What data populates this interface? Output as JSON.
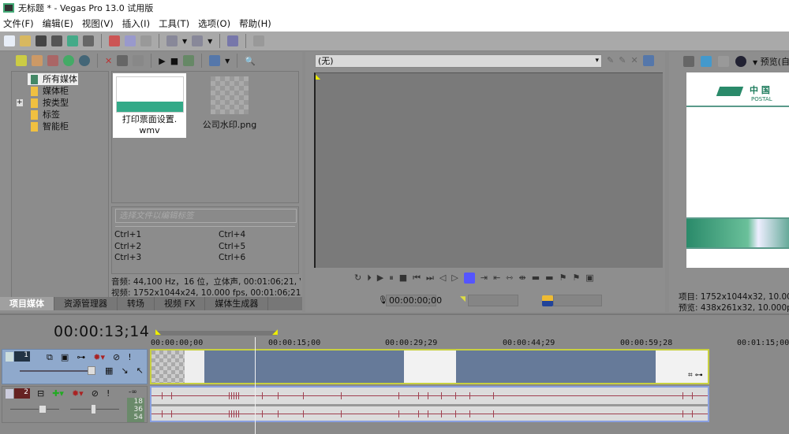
{
  "window": {
    "title": "无标题 * - Vegas Pro 13.0 试用版"
  },
  "menu": [
    "文件(F)",
    "编辑(E)",
    "视图(V)",
    "插入(I)",
    "工具(T)",
    "选项(O)",
    "帮助(H)"
  ],
  "media_panel": {
    "tree": [
      {
        "label": "所有媒体",
        "selected": true
      },
      {
        "label": "媒体柜"
      },
      {
        "label": "按类型",
        "expandable": true
      },
      {
        "label": "标签"
      },
      {
        "label": "智能柜"
      }
    ],
    "files": [
      {
        "name_line1": "打印票面设置.",
        "name_line2": "wmv",
        "selected": true
      },
      {
        "name_line1": "公司水印.png"
      }
    ],
    "tag_placeholder": "选择文件以编辑标签",
    "shortcuts": [
      "Ctrl+1",
      "Ctrl+2",
      "Ctrl+3",
      "Ctrl+4",
      "Ctrl+5",
      "Ctrl+6"
    ],
    "audio_info": "音频: 44,100 Hz，16 位，立体声, 00:01:06;21, V",
    "video_info": "视频: 1752x1044x24, 10.000 fps, 00:01:06;21, A"
  },
  "tabs": [
    {
      "label": "项目媒体",
      "active": true
    },
    {
      "label": "资源管理器"
    },
    {
      "label": "转场"
    },
    {
      "label": "视频 FX"
    },
    {
      "label": "媒体生成器"
    }
  ],
  "preview": {
    "dropdown_value": "(无)",
    "timecode": "00:00:00;00"
  },
  "trimmer": {
    "mode": "预览(自",
    "project_info": "项目: 1752x1044x32, 10.000",
    "preview_info": "预览: 438x261x32, 10.000p",
    "logo_text": "中 国",
    "logo_sub": "POSTAL"
  },
  "timeline": {
    "current_time": "00:00:13;14",
    "ruler": [
      "00:00:00;00",
      "00:00:15;00",
      "00:00:29;29",
      "00:00:44;29",
      "00:00:59;28",
      "00:01:15;00"
    ],
    "video_track_number": "1",
    "audio_track_number": "2",
    "audio_volume": "-∞",
    "meter": [
      "18",
      "36",
      "54"
    ],
    "accent_video": "#667a99",
    "accent_selection": "#c8d040"
  }
}
